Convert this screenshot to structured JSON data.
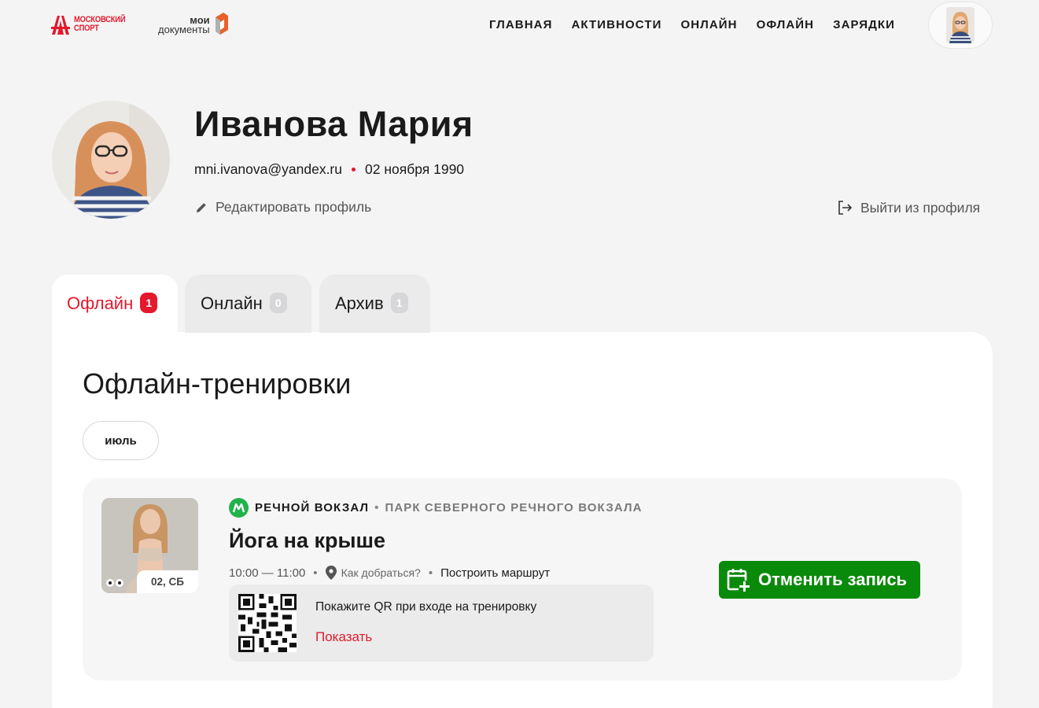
{
  "header": {
    "logo_ms_line1": "МОСКОВСКИЙ",
    "logo_ms_line2": "СПОРТ",
    "logo_md_line1": "мои",
    "logo_md_line2": "документы",
    "nav": [
      "ГЛАВНАЯ",
      "АКТИВНОСТИ",
      "ОНЛАЙН",
      "ОФЛАЙН",
      "ЗАРЯДКИ"
    ]
  },
  "profile": {
    "name": "Иванова Мария",
    "email": "mni.ivanova@yandex.ru",
    "birthdate": "02 ноября 1990",
    "edit_label": "Редактировать профиль",
    "logout_label": "Выйти из профиля"
  },
  "tabs": [
    {
      "label": "Офлайн",
      "count": "1",
      "active": true
    },
    {
      "label": "Онлайн",
      "count": "0",
      "active": false
    },
    {
      "label": "Архив",
      "count": "1",
      "active": false
    }
  ],
  "section": {
    "title": "Офлайн-тренировки",
    "month": "июль"
  },
  "event": {
    "station": "РЕЧНОЙ ВОКЗАЛ",
    "park": "ПАРК СЕВЕРНОГО РЕЧНОГО ВОКЗАЛА",
    "title": "Йога на крыше",
    "time": "10:00 — 11:00",
    "how_to_get": "Как добраться?",
    "route": "Построить маршрут",
    "date_chip": "02, СБ",
    "qr_hint": "Покажите QR при входе на тренировку",
    "qr_show": "Показать",
    "cancel_label": "Отменить запись"
  },
  "colors": {
    "accent": "#e4192c",
    "metro": "#22b24c",
    "cancel_button": "#0a8a0a",
    "background": "#f4f4f5"
  },
  "icons": {
    "edit": "pencil-icon",
    "logout": "logout-icon",
    "metro": "metro-icon",
    "location": "location-pin-icon",
    "calendar_cancel": "calendar-plus-icon"
  }
}
